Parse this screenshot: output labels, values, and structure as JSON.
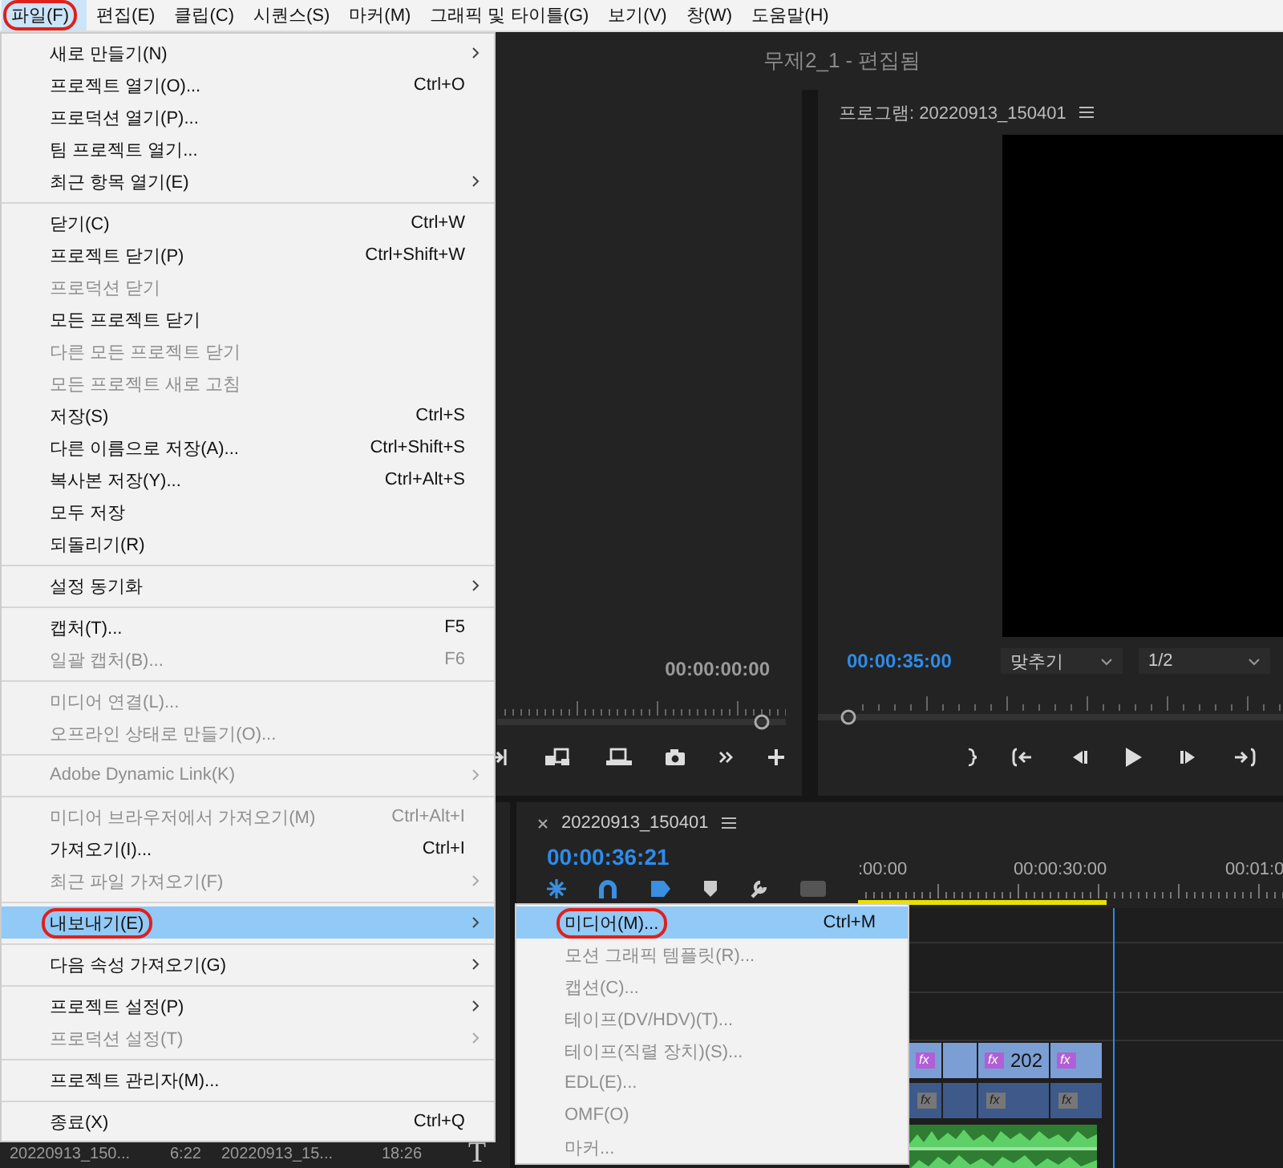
{
  "menubar": [
    {
      "label": "파일(F)",
      "selected": true,
      "circled": true
    },
    {
      "label": "편집(E)",
      "selected": false,
      "circled": false
    },
    {
      "label": "클립(C)",
      "selected": false,
      "circled": false
    },
    {
      "label": "시퀀스(S)",
      "selected": false,
      "circled": false
    },
    {
      "label": "마커(M)",
      "selected": false,
      "circled": false
    },
    {
      "label": "그래픽 및 타이틀(G)",
      "selected": false,
      "circled": false
    },
    {
      "label": "보기(V)",
      "selected": false,
      "circled": false
    },
    {
      "label": "창(W)",
      "selected": false,
      "circled": false
    },
    {
      "label": "도움말(H)",
      "selected": false,
      "circled": false
    }
  ],
  "window": {
    "title": "무제2_1 - 편집됨"
  },
  "source_monitor": {
    "timecode": "00:00:00:00"
  },
  "program_monitor": {
    "title": "프로그램: 20220913_150401",
    "timecode": "00:00:35:00",
    "zoom": "맞추기",
    "resolution": "1/2"
  },
  "timeline": {
    "tab": "20220913_150401",
    "timecode": "00:00:36:21",
    "ruler_labels": [
      ":00:00",
      "00:00:30:00",
      "00:01:0"
    ],
    "clips": [
      {
        "effect": true,
        "badge": "fx"
      },
      {
        "effect": false
      },
      {
        "effect": true,
        "label": "202",
        "badge": "fx"
      },
      {
        "effect": true,
        "badge": "fx"
      }
    ],
    "audio_clips": [
      {
        "effect": true,
        "badge": "fx"
      },
      {
        "effect": false
      },
      {
        "effect": true,
        "badge": "fx"
      },
      {
        "effect": true,
        "badge": "fx"
      }
    ]
  },
  "project": {
    "cells": [
      "20220913_150...",
      "6:22",
      "20220913_15...",
      "18:26"
    ],
    "letter": "T"
  },
  "file_menu": {
    "groups": [
      {
        "items": [
          {
            "label": "새로 만들기(N)",
            "disabled": false,
            "submenu": true,
            "selected": false,
            "circled": false
          },
          {
            "label": "프로젝트 열기(O)...",
            "shortcut": "Ctrl+O",
            "disabled": false,
            "submenu": false,
            "selected": false,
            "circled": false
          },
          {
            "label": "프로덕션 열기(P)...",
            "disabled": false,
            "submenu": false,
            "selected": false,
            "circled": false
          },
          {
            "label": "팀 프로젝트 열기...",
            "disabled": false,
            "submenu": false,
            "selected": false,
            "circled": false
          },
          {
            "label": "최근 항목 열기(E)",
            "disabled": false,
            "submenu": true,
            "selected": false,
            "circled": false
          }
        ]
      },
      {
        "items": [
          {
            "label": "닫기(C)",
            "shortcut": "Ctrl+W",
            "disabled": false,
            "submenu": false,
            "selected": false,
            "circled": false
          },
          {
            "label": "프로젝트 닫기(P)",
            "shortcut": "Ctrl+Shift+W",
            "disabled": false,
            "submenu": false,
            "selected": false,
            "circled": false
          },
          {
            "label": "프로덕션 닫기",
            "disabled": true,
            "submenu": false,
            "selected": false,
            "circled": false
          },
          {
            "label": "모든 프로젝트 닫기",
            "disabled": false,
            "submenu": false,
            "selected": false,
            "circled": false
          },
          {
            "label": "다른 모든 프로젝트 닫기",
            "disabled": true,
            "submenu": false,
            "selected": false,
            "circled": false
          },
          {
            "label": "모든 프로젝트 새로 고침",
            "disabled": true,
            "submenu": false,
            "selected": false,
            "circled": false
          },
          {
            "label": "저장(S)",
            "shortcut": "Ctrl+S",
            "disabled": false,
            "submenu": false,
            "selected": false,
            "circled": false
          },
          {
            "label": "다른 이름으로 저장(A)...",
            "shortcut": "Ctrl+Shift+S",
            "disabled": false,
            "submenu": false,
            "selected": false,
            "circled": false
          },
          {
            "label": "복사본 저장(Y)...",
            "shortcut": "Ctrl+Alt+S",
            "disabled": false,
            "submenu": false,
            "selected": false,
            "circled": false
          },
          {
            "label": "모두 저장",
            "disabled": false,
            "submenu": false,
            "selected": false,
            "circled": false
          },
          {
            "label": "되돌리기(R)",
            "disabled": false,
            "submenu": false,
            "selected": false,
            "circled": false
          }
        ]
      },
      {
        "items": [
          {
            "label": "설정 동기화",
            "disabled": false,
            "submenu": true,
            "selected": false,
            "circled": false
          }
        ]
      },
      {
        "items": [
          {
            "label": "캡처(T)...",
            "shortcut": "F5",
            "disabled": false,
            "submenu": false,
            "selected": false,
            "circled": false
          },
          {
            "label": "일괄 캡처(B)...",
            "shortcut": "F6",
            "disabled": true,
            "submenu": false,
            "selected": false,
            "circled": false
          }
        ]
      },
      {
        "items": [
          {
            "label": "미디어 연결(L)...",
            "disabled": true,
            "submenu": false,
            "selected": false,
            "circled": false
          },
          {
            "label": "오프라인 상태로 만들기(O)...",
            "disabled": true,
            "submenu": false,
            "selected": false,
            "circled": false
          }
        ]
      },
      {
        "items": [
          {
            "label": "Adobe Dynamic Link(K)",
            "disabled": true,
            "submenu": true,
            "selected": false,
            "circled": false
          }
        ]
      },
      {
        "items": [
          {
            "label": "미디어 브라우저에서 가져오기(M)",
            "shortcut": "Ctrl+Alt+I",
            "disabled": true,
            "submenu": false,
            "selected": false,
            "circled": false
          },
          {
            "label": "가져오기(I)...",
            "shortcut": "Ctrl+I",
            "disabled": false,
            "submenu": false,
            "selected": false,
            "circled": false
          },
          {
            "label": "최근 파일 가져오기(F)",
            "disabled": true,
            "submenu": true,
            "selected": false,
            "circled": false
          }
        ]
      },
      {
        "items": [
          {
            "label": "내보내기(E)",
            "disabled": false,
            "submenu": true,
            "selected": true,
            "circled": true
          }
        ]
      },
      {
        "items": [
          {
            "label": "다음 속성 가져오기(G)",
            "disabled": false,
            "submenu": true,
            "selected": false,
            "circled": false
          }
        ]
      },
      {
        "items": [
          {
            "label": "프로젝트 설정(P)",
            "disabled": false,
            "submenu": true,
            "selected": false,
            "circled": false
          },
          {
            "label": "프로덕션 설정(T)",
            "disabled": true,
            "submenu": true,
            "selected": false,
            "circled": false
          }
        ]
      },
      {
        "items": [
          {
            "label": "프로젝트 관리자(M)...",
            "disabled": false,
            "submenu": false,
            "selected": false,
            "circled": false
          }
        ]
      },
      {
        "items": [
          {
            "label": "종료(X)",
            "shortcut": "Ctrl+Q",
            "disabled": false,
            "submenu": false,
            "selected": false,
            "circled": false
          }
        ]
      }
    ]
  },
  "export_submenu": {
    "items": [
      {
        "label": "미디어(M)...",
        "shortcut": "Ctrl+M",
        "disabled": false,
        "selected": true,
        "circled": true
      },
      {
        "label": "모션 그래픽 템플릿(R)...",
        "disabled": true,
        "selected": false,
        "circled": false
      },
      {
        "label": "캡션(C)...",
        "disabled": true,
        "selected": false,
        "circled": false
      },
      {
        "label": "테이프(DV/HDV)(T)...",
        "disabled": true,
        "selected": false,
        "circled": false
      },
      {
        "label": "테이프(직렬 장치)(S)...",
        "disabled": true,
        "selected": false,
        "circled": false
      },
      {
        "label": "EDL(E)...",
        "disabled": true,
        "selected": false,
        "circled": false
      },
      {
        "label": "OMF(O)",
        "disabled": true,
        "selected": false,
        "circled": false
      },
      {
        "label": "마커...",
        "disabled": true,
        "selected": false,
        "circled": false
      }
    ]
  }
}
